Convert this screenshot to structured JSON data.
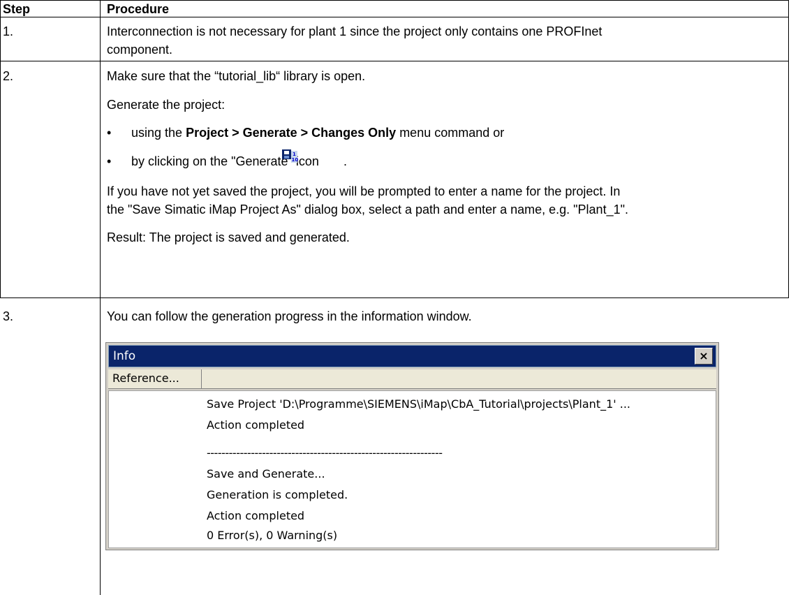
{
  "table": {
    "headers": {
      "step": "Step",
      "procedure": "Procedure"
    },
    "rows": [
      {
        "step": "1.",
        "lines": [
          "Interconnection is not necessary for plant 1 since the project only contains one PROFInet",
          "component."
        ]
      },
      {
        "step": "2.",
        "intro": "Make sure that the “tutorial_lib“ library is open.",
        "generate_label": "Generate the project:",
        "bullet_1": {
          "prefix": "using the ",
          "bold": "Project > Generate > Changes Only",
          "suffix": " menu command or"
        },
        "bullet_2": {
          "prefix": "by clicking on the \"Generate\" icon ",
          "suffix": "."
        },
        "prompt_line_1": "If you have not yet saved the project, you will be prompted to enter a name for the project. In",
        "prompt_line_2": "the \"Save Simatic iMap Project As\" dialog box, select a path and enter a name, e.g. \"Plant_1\".",
        "result": "Result: The project is saved and generated."
      },
      {
        "step": "3.",
        "intro": "You can follow the generation progress in the information window."
      }
    ]
  },
  "info_window": {
    "title": "Info",
    "close_label": "×",
    "tab_label": "Reference...",
    "log_lines": [
      "Save Project 'D:\\Programme\\SIEMENS\\iMap\\CbA_Tutorial\\projects\\Plant_1' ...",
      "Action completed",
      "----------------------------------------------------------------",
      "Save and Generate...",
      "Generation is completed.",
      "Action completed",
      "0 Error(s), 0 Warning(s)"
    ]
  },
  "icons": {
    "bullet": "•",
    "generate_icon": "generate-icon"
  }
}
